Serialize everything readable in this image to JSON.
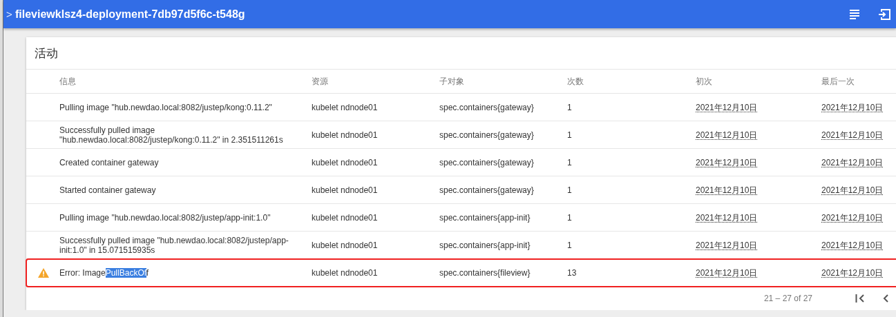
{
  "toolbar": {
    "expand_glyph": ">",
    "title": "fileviewklsz4-deployment-7db97d5f6c-t548g"
  },
  "card": {
    "title": "活动",
    "columns": [
      "信息",
      "资源",
      "子对象",
      "次数",
      "初次",
      "最后一次"
    ],
    "rows": [
      {
        "warning": false,
        "annotated": false,
        "message": [
          {
            "text": "Pulling image \"hub.newdao.local:8082/justep/kong:0.11.2\"",
            "selected": false
          }
        ],
        "source": "kubelet ndnode01",
        "sub_object": "spec.containers{gateway}",
        "count": "1",
        "first_seen": "2021年12月10日",
        "last_seen": "2021年12月10日"
      },
      {
        "warning": false,
        "annotated": false,
        "message": [
          {
            "text": "Successfully pulled image \"hub.newdao.local:8082/justep/kong:0.11.2\" in 2.351511261s",
            "selected": false
          }
        ],
        "source": "kubelet ndnode01",
        "sub_object": "spec.containers{gateway}",
        "count": "1",
        "first_seen": "2021年12月10日",
        "last_seen": "2021年12月10日"
      },
      {
        "warning": false,
        "annotated": false,
        "message": [
          {
            "text": "Created container gateway",
            "selected": false
          }
        ],
        "source": "kubelet ndnode01",
        "sub_object": "spec.containers{gateway}",
        "count": "1",
        "first_seen": "2021年12月10日",
        "last_seen": "2021年12月10日"
      },
      {
        "warning": false,
        "annotated": false,
        "message": [
          {
            "text": "Started container gateway",
            "selected": false
          }
        ],
        "source": "kubelet ndnode01",
        "sub_object": "spec.containers{gateway}",
        "count": "1",
        "first_seen": "2021年12月10日",
        "last_seen": "2021年12月10日"
      },
      {
        "warning": false,
        "annotated": false,
        "message": [
          {
            "text": "Pulling image \"hub.newdao.local:8082/justep/app-init:1.0\"",
            "selected": false
          }
        ],
        "source": "kubelet ndnode01",
        "sub_object": "spec.containers{app-init}",
        "count": "1",
        "first_seen": "2021年12月10日",
        "last_seen": "2021年12月10日"
      },
      {
        "warning": false,
        "annotated": false,
        "message": [
          {
            "text": "Successfully pulled image \"hub.newdao.local:8082/justep/app-init:1.0\" in 15.071515935s",
            "selected": false
          }
        ],
        "source": "kubelet ndnode01",
        "sub_object": "spec.containers{app-init}",
        "count": "1",
        "first_seen": "2021年12月10日",
        "last_seen": "2021年12月10日"
      },
      {
        "warning": true,
        "annotated": true,
        "message": [
          {
            "text": "Error: Image",
            "selected": false
          },
          {
            "text": "PullBackOf",
            "selected": true
          },
          {
            "text": "f",
            "selected": false
          }
        ],
        "source": "kubelet ndnode01",
        "sub_object": "spec.containers{fileview}",
        "count": "13",
        "first_seen": "2021年12月10日",
        "last_seen": "2021年12月10日"
      }
    ],
    "pagination": {
      "range": "21 – 27 of 27"
    }
  }
}
